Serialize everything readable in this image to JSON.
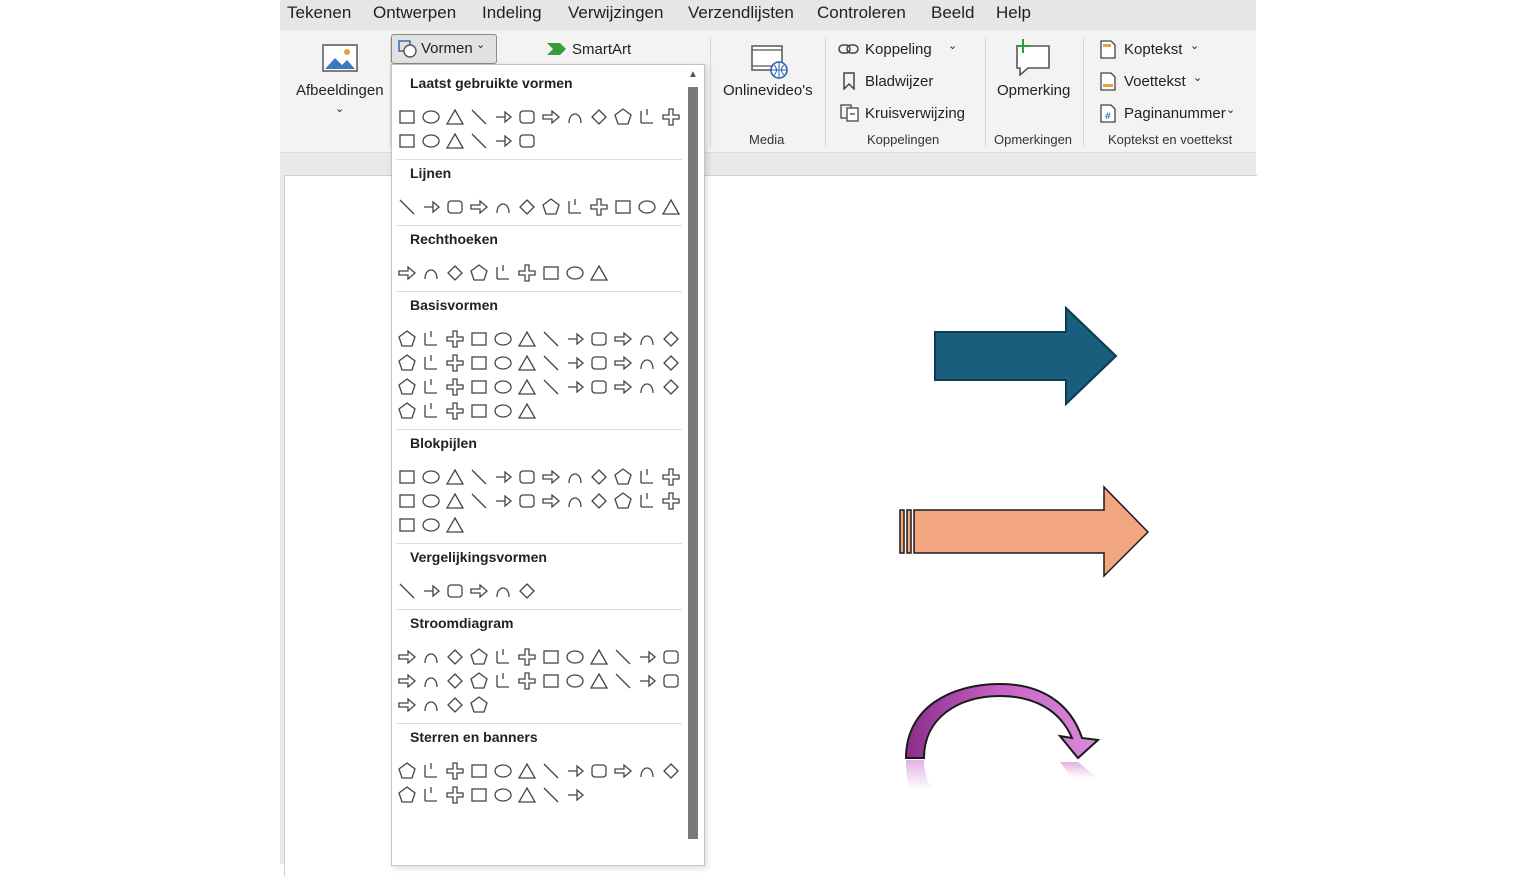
{
  "menu": [
    "Tekenen",
    "Ontwerpen",
    "Indeling",
    "Verwijzingen",
    "Verzendlijsten",
    "Controleren",
    "Beeld",
    "Help"
  ],
  "ribbon": {
    "afbeeldingen": "Afbeeldingen",
    "vormen": "Vormen",
    "smartart": "SmartArt",
    "onlinevideos": "Onlinevideo's",
    "koppeling": "Koppeling",
    "bladwijzer": "Bladwijzer",
    "kruisverwijzing": "Kruisverwijzing",
    "opmerking": "Opmerking",
    "koptekst": "Koptekst",
    "voettekst": "Voettekst",
    "paginanummer": "Paginanummer",
    "groups": {
      "media": "Media",
      "koppelingen": "Koppelingen",
      "opmerkingen": "Opmerkingen",
      "koptekst_voettekst": "Koptekst en voettekst"
    }
  },
  "shapes_menu": {
    "sections": [
      {
        "title": "Laatst gebruikte vormen",
        "rows": [
          12,
          6
        ]
      },
      {
        "title": "Lijnen",
        "rows": [
          12
        ]
      },
      {
        "title": "Rechthoeken",
        "rows": [
          9
        ]
      },
      {
        "title": "Basisvormen",
        "rows": [
          12,
          12,
          12,
          6
        ]
      },
      {
        "title": "Blokpijlen",
        "rows": [
          12,
          12,
          3
        ]
      },
      {
        "title": "Vergelijkingsvormen",
        "rows": [
          6
        ]
      },
      {
        "title": "Stroomdiagram",
        "rows": [
          12,
          12,
          4
        ]
      },
      {
        "title": "Sterren en banners",
        "rows": [
          12,
          8
        ]
      }
    ]
  },
  "canvas_shapes": {
    "arrow1_color": "#195e7d",
    "arrow2_color": "#f2a680",
    "arrow3_color": "#c060c0"
  }
}
